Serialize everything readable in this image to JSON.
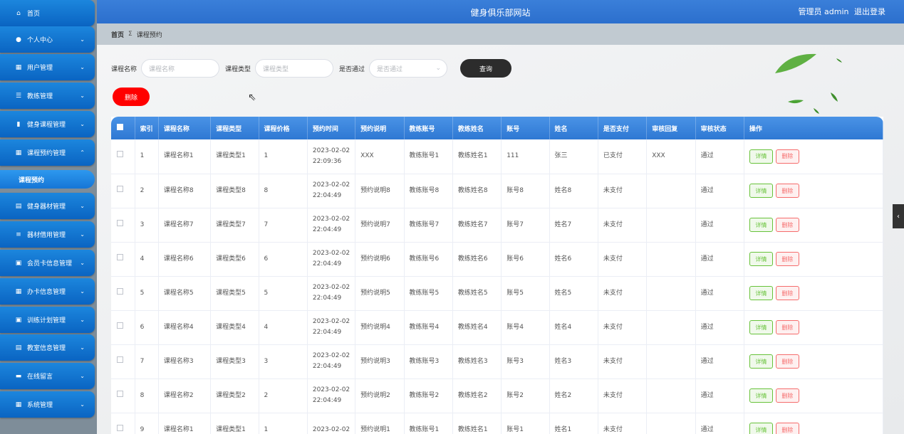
{
  "sidebar": {
    "items": [
      {
        "icon": "⌂",
        "label": "首页",
        "chevron": ""
      },
      {
        "icon": "●",
        "label": "个人中心",
        "chevron": "⌄"
      },
      {
        "icon": "▦",
        "label": "用户管理",
        "chevron": "⌄"
      },
      {
        "icon": "☰",
        "label": "教练管理",
        "chevron": "⌄"
      },
      {
        "icon": "▮",
        "label": "健身课程管理",
        "chevron": "⌄"
      },
      {
        "icon": "▦",
        "label": "课程预约管理",
        "chevron": "⌃"
      },
      {
        "icon": "",
        "label": "课程预约",
        "chevron": ""
      },
      {
        "icon": "▤",
        "label": "健身器材管理",
        "chevron": "⌄"
      },
      {
        "icon": "≡",
        "label": "器材借用管理",
        "chevron": "⌄"
      },
      {
        "icon": "▣",
        "label": "会员卡信息管理",
        "chevron": "⌄"
      },
      {
        "icon": "▦",
        "label": "办卡信息管理",
        "chevron": "⌄"
      },
      {
        "icon": "▣",
        "label": "训练计划管理",
        "chevron": "⌄"
      },
      {
        "icon": "▤",
        "label": "教室信息管理",
        "chevron": "⌄"
      },
      {
        "icon": "▬",
        "label": "在线留言",
        "chevron": "⌄"
      },
      {
        "icon": "▦",
        "label": "系统管理",
        "chevron": "⌄"
      }
    ]
  },
  "header": {
    "site_title": "健身俱乐部网站",
    "admin_label": "管理员 admin",
    "logout_label": "退出登录"
  },
  "breadcrumb": {
    "home": "首页",
    "separator": "Σ",
    "current": "课程预约"
  },
  "search": {
    "course_name_label": "课程名称",
    "course_name_placeholder": "课程名称",
    "course_type_label": "课程类型",
    "course_type_placeholder": "课程类型",
    "passed_label": "是否通过",
    "passed_placeholder": "是否通过",
    "query_button": "查询"
  },
  "actions": {
    "delete_button": "删除"
  },
  "table": {
    "columns": [
      "索引",
      "课程名称",
      "课程类型",
      "课程价格",
      "预约时间",
      "预约说明",
      "教练账号",
      "教练姓名",
      "账号",
      "姓名",
      "是否支付",
      "审核回复",
      "审核状态",
      "操作"
    ],
    "detail_label": "详情",
    "delete_label": "删除",
    "rows": [
      {
        "index": "1",
        "course_name": "课程名称1",
        "course_type": "课程类型1",
        "price": "1",
        "time_date": "2023-02-02",
        "time_clock": "22:09:36",
        "note": "XXX",
        "coach_account": "教练账号1",
        "coach_name": "教练姓名1",
        "account": "111",
        "name": "张三",
        "paid": "已支付",
        "reply": "XXX",
        "status": "通过"
      },
      {
        "index": "2",
        "course_name": "课程名称8",
        "course_type": "课程类型8",
        "price": "8",
        "time_date": "2023-02-02",
        "time_clock": "22:04:49",
        "note": "预约说明8",
        "coach_account": "教练账号8",
        "coach_name": "教练姓名8",
        "account": "账号8",
        "name": "姓名8",
        "paid": "未支付",
        "reply": "",
        "status": "通过"
      },
      {
        "index": "3",
        "course_name": "课程名称7",
        "course_type": "课程类型7",
        "price": "7",
        "time_date": "2023-02-02",
        "time_clock": "22:04:49",
        "note": "预约说明7",
        "coach_account": "教练账号7",
        "coach_name": "教练姓名7",
        "account": "账号7",
        "name": "姓名7",
        "paid": "未支付",
        "reply": "",
        "status": "通过"
      },
      {
        "index": "4",
        "course_name": "课程名称6",
        "course_type": "课程类型6",
        "price": "6",
        "time_date": "2023-02-02",
        "time_clock": "22:04:49",
        "note": "预约说明6",
        "coach_account": "教练账号6",
        "coach_name": "教练姓名6",
        "account": "账号6",
        "name": "姓名6",
        "paid": "未支付",
        "reply": "",
        "status": "通过"
      },
      {
        "index": "5",
        "course_name": "课程名称5",
        "course_type": "课程类型5",
        "price": "5",
        "time_date": "2023-02-02",
        "time_clock": "22:04:49",
        "note": "预约说明5",
        "coach_account": "教练账号5",
        "coach_name": "教练姓名5",
        "account": "账号5",
        "name": "姓名5",
        "paid": "未支付",
        "reply": "",
        "status": "通过"
      },
      {
        "index": "6",
        "course_name": "课程名称4",
        "course_type": "课程类型4",
        "price": "4",
        "time_date": "2023-02-02",
        "time_clock": "22:04:49",
        "note": "预约说明4",
        "coach_account": "教练账号4",
        "coach_name": "教练姓名4",
        "account": "账号4",
        "name": "姓名4",
        "paid": "未支付",
        "reply": "",
        "status": "通过"
      },
      {
        "index": "7",
        "course_name": "课程名称3",
        "course_type": "课程类型3",
        "price": "3",
        "time_date": "2023-02-02",
        "time_clock": "22:04:49",
        "note": "预约说明3",
        "coach_account": "教练账号3",
        "coach_name": "教练姓名3",
        "account": "账号3",
        "name": "姓名3",
        "paid": "未支付",
        "reply": "",
        "status": "通过"
      },
      {
        "index": "8",
        "course_name": "课程名称2",
        "course_type": "课程类型2",
        "price": "2",
        "time_date": "2023-02-02",
        "time_clock": "22:04:49",
        "note": "预约说明2",
        "coach_account": "教练账号2",
        "coach_name": "教练姓名2",
        "account": "账号2",
        "name": "姓名2",
        "paid": "未支付",
        "reply": "",
        "status": "通过"
      },
      {
        "index": "9",
        "course_name": "课程名称1",
        "course_type": "课程类型1",
        "price": "1",
        "time_date": "2023-02-02",
        "time_clock": "",
        "note": "预约说明1",
        "coach_account": "教练账号1",
        "coach_name": "教练姓名1",
        "account": "账号1",
        "name": "姓名1",
        "paid": "未支付",
        "reply": "",
        "status": "通过"
      }
    ]
  },
  "colors": {
    "header": "#2c6fcd",
    "nav": "#0a64c2",
    "danger": "#ff0000",
    "success": "#67c23a"
  }
}
